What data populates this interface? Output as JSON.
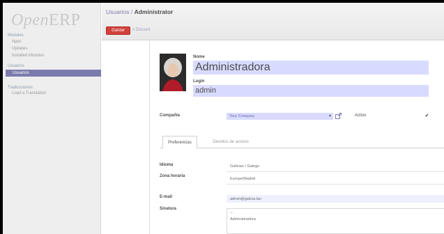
{
  "app": {
    "logo_open": "Open",
    "logo_erp": "ERP"
  },
  "sidebar": {
    "sections": [
      {
        "title": "Modules",
        "items": [
          {
            "label": "Apps"
          },
          {
            "label": "Updates"
          },
          {
            "label": "Installed Modules"
          }
        ]
      },
      {
        "title": "Usuarios",
        "items": [
          {
            "label": "Usuarios",
            "active": true
          }
        ]
      },
      {
        "title": "Traducciones",
        "items": [
          {
            "label": "Load a Translation"
          }
        ]
      }
    ]
  },
  "header": {
    "breadcrumb": {
      "parent": "Usuarios",
      "separator": " / ",
      "current": "Administrator"
    },
    "save_label": "Gardar",
    "or_text": "o",
    "discard_label": "Discard"
  },
  "form": {
    "name_label": "Nome",
    "name_value": "Administradora",
    "login_label": "Login",
    "login_value": "admin",
    "company_label": "Compañía",
    "company_value": "Your Company",
    "active_label": "Activo",
    "active_checked": "✔",
    "tabs": [
      {
        "label": "Preferencias",
        "active": true
      },
      {
        "label": "Dereitos de acceso",
        "active": false
      }
    ],
    "language_label": "Idioma",
    "language_value": "Galician / Galego",
    "timezone_label": "Zona horaria",
    "timezone_value": "Europe/Madrid",
    "email_label": "E-mail",
    "email_value": "admin@galicia.lan",
    "signature_label": "Sinatura",
    "signature_value": "--\nAdministradora"
  },
  "colors": {
    "accent": "#7c7bad",
    "save": "#d2413c",
    "highlight": "#d8dbff"
  }
}
